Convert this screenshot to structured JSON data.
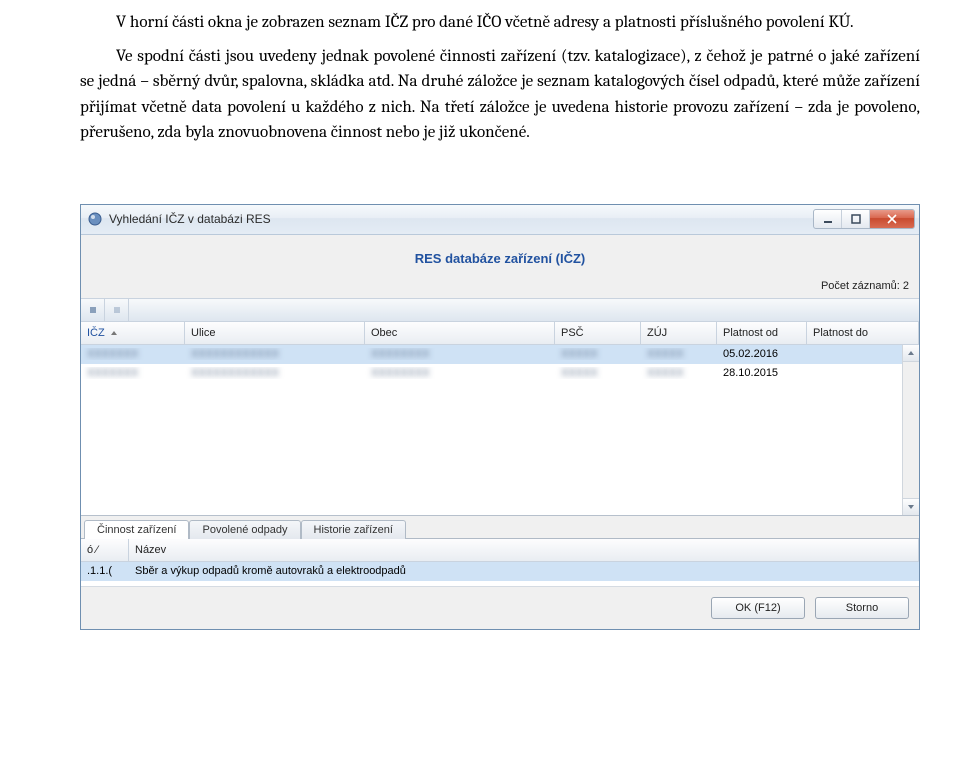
{
  "doc": {
    "para1": "V horní části okna je zobrazen seznam IČZ pro dané IČO včetně adresy a platnosti příslušného povolení KÚ.",
    "para2": "Ve spodní části jsou uvedeny jednak povolené činnosti zařízení (tzv. katalogizace), z čehož je patrné o jaké zařízení se jedná – sběrný dvůr, spalovna, skládka atd. Na druhé záložce je seznam katalogových čísel odpadů, které může zařízení přijímat včetně data povolení u každého z nich. Na třetí záložce je uvedena historie provozu zařízení – zda je povoleno, přerušeno, zda byla znovuobnovena činnost nebo je již ukončené."
  },
  "window": {
    "title": "Vyhledání IČZ v databázi RES",
    "heading": "RES databáze zařízení (IČZ)",
    "record_count": "Počet záznamů: 2"
  },
  "grid": {
    "headers": {
      "icz": "IČZ",
      "ulice": "Ulice",
      "obec": "Obec",
      "psc": "PSČ",
      "zuj": "ZÚJ",
      "platnost_od": "Platnost od",
      "platnost_do": "Platnost do"
    },
    "rows": [
      {
        "platnost_od": "05.02.2016"
      },
      {
        "platnost_od": "28.10.2015"
      }
    ],
    "blur_placeholder_1": "XXXXXXX",
    "blur_placeholder_2": "XXXXXXXXXXXX",
    "blur_placeholder_3": "XXXXXXXX",
    "blur_placeholder_4": "XXXXX",
    "blur_placeholder_5": "XXXXX"
  },
  "tabs": {
    "items": [
      {
        "label": "Činnost zařízení"
      },
      {
        "label": "Povolené odpady"
      },
      {
        "label": "Historie zařízení"
      }
    ]
  },
  "grid2": {
    "headers": {
      "id": "ó  ⁄",
      "name": "Název"
    },
    "row": {
      "id": ".1.1.(",
      "name": "Sběr a výkup odpadů kromě autovraků a elektroodpadů"
    }
  },
  "footer": {
    "ok": "OK (F12)",
    "cancel": "Storno"
  }
}
